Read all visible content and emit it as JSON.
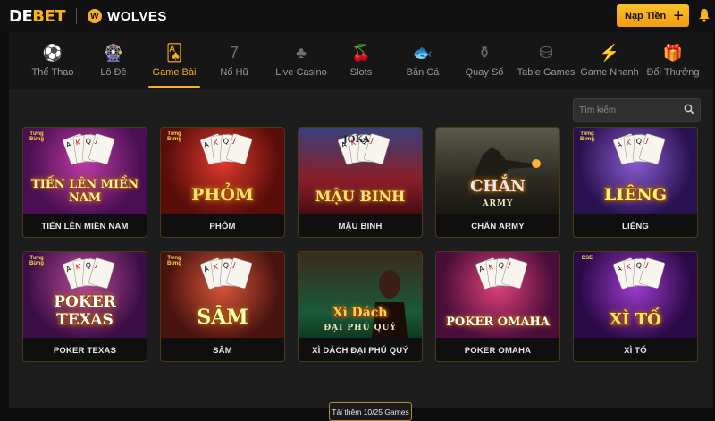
{
  "header": {
    "logo_main": "DE",
    "logo_accent": "BET",
    "partner": "WOLVES",
    "deposit_label": "Nạp Tiền",
    "deposit_plus": "+",
    "bell": "🔔"
  },
  "nav": {
    "items": [
      {
        "label": "Thể Thao",
        "icon": "⚽"
      },
      {
        "label": "Lô Đề",
        "icon": "🎡"
      },
      {
        "label": "Game Bài",
        "icon": "🂡"
      },
      {
        "label": "Nổ Hũ",
        "icon": "7"
      },
      {
        "label": "Live Casino",
        "icon": "♣"
      },
      {
        "label": "Slots",
        "icon": "🍒"
      },
      {
        "label": "Bắn Cá",
        "icon": "🐟"
      },
      {
        "label": "Quay Số",
        "icon": "⚱"
      },
      {
        "label": "Table Games",
        "icon": "⛁"
      },
      {
        "label": "Game Nhanh",
        "icon": "⚡"
      },
      {
        "label": "Đổi Thưởng",
        "icon": "🎁"
      }
    ],
    "active_index": 2
  },
  "search": {
    "placeholder": "Tìm kiếm",
    "icon": "🔍"
  },
  "games": [
    {
      "name": "TIẾN LÊN MIỀN NAM",
      "art_title": "TIẾN LÊN MIỀN NAM",
      "badge": "Tưng Bừng"
    },
    {
      "name": "PHỎM",
      "art_title": "PHỎM",
      "badge": "Tưng Bừng"
    },
    {
      "name": "MẬU BINH",
      "art_title": "MẬU BINH",
      "art_top": "JOKA"
    },
    {
      "name": "CHẮN ARMY",
      "art_title": "CHẮN",
      "art_sub": "ARMY"
    },
    {
      "name": "LIÊNG",
      "art_title": "LIÊNG",
      "badge": "Tưng Bừng"
    },
    {
      "name": "POKER TEXAS",
      "art_title": "POKER TEXAS",
      "badge": "Tưng Bừng"
    },
    {
      "name": "SÂM",
      "art_title": "SÂM",
      "badge": "Tưng Bừng"
    },
    {
      "name": "XÌ DÁCH ĐẠI PHÚ QUÝ",
      "art_title": "Xì Dách",
      "art_sub": "ĐẠI PHÚ QUÝ"
    },
    {
      "name": "POKER OMAHA",
      "art_title": "POKER OMAHA"
    },
    {
      "name": "XÌ TỐ",
      "art_title": "XÌ TỐ",
      "badge": "DSE"
    }
  ],
  "load_more": "Tải thêm 10/25 Games",
  "colors": {
    "accent": "#f6b021",
    "panel": "#1d1d1d",
    "nav": "#161616"
  }
}
